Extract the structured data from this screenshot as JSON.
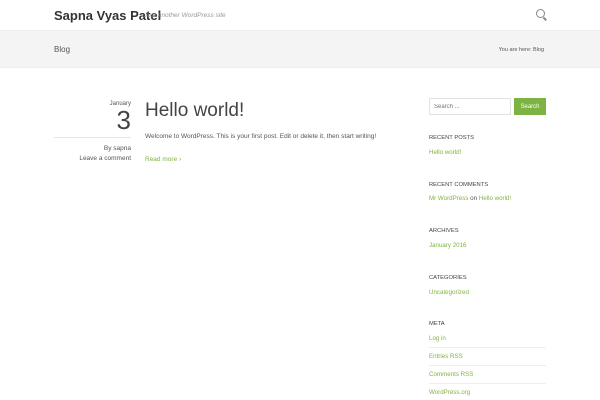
{
  "site": {
    "title": "Sapna Vyas Patel",
    "tagline": "Just another WordPress site"
  },
  "titlebar": {
    "page_title": "Blog",
    "breadcrumb": "You are here:  Blog"
  },
  "post": {
    "month": "January",
    "day": "3",
    "author": "By  sapna",
    "comments": "Leave a comment",
    "title": "Hello world!",
    "excerpt": "Welcome to WordPress. This is your first post. Edit or delete it, then start writing!",
    "read_more": "Read more ›"
  },
  "sidebar": {
    "search": {
      "placeholder": "Search ...",
      "button": "Search"
    },
    "recent_posts": {
      "title": "RECENT POSTS",
      "items": [
        "Hello world!"
      ]
    },
    "recent_comments": {
      "title": "RECENT COMMENTS",
      "author": "Mr WordPress",
      "on": "on",
      "post": "Hello world!"
    },
    "archives": {
      "title": "ARCHIVES",
      "items": [
        "January 2016"
      ]
    },
    "categories": {
      "title": "CATEGORIES",
      "items": [
        "Uncategorized"
      ]
    },
    "meta": {
      "title": "META",
      "items": [
        "Log in",
        "Entries RSS",
        "Comments RSS",
        "WordPress.org"
      ]
    }
  },
  "colors": {
    "accent": "#7cb342"
  }
}
